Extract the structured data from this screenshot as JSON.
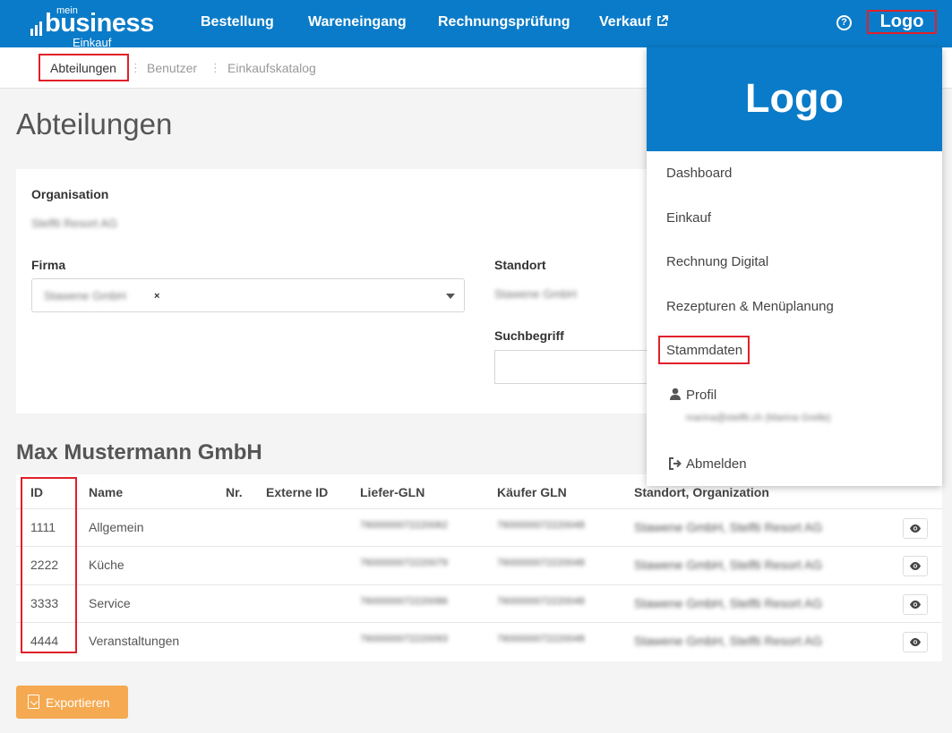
{
  "brand": {
    "mein": "mein",
    "business": "business",
    "badge": "Einkauf"
  },
  "nav": {
    "items": [
      "Bestellung",
      "Wareneingang",
      "Rechnungsprüfung",
      "Verkauf"
    ],
    "help": "?",
    "logo": "Logo"
  },
  "subnav": {
    "items": [
      "Abteilungen",
      "Benutzer",
      "Einkaufskatalog"
    ]
  },
  "page": {
    "title": "Abteilungen"
  },
  "filters": {
    "organisation_label": "Organisation",
    "organisation_value": "Stelfti Resort AG",
    "firma_label": "Firma",
    "firma_value": "Stawene GmbH",
    "clear": "×",
    "standort_label": "Standort",
    "standort_value": "Stawene GmbH",
    "suchbegriff_label": "Suchbegriff",
    "suchbegriff_value": ""
  },
  "company": "Max Mustermann GmbH",
  "table": {
    "headers": [
      "ID",
      "Name",
      "Nr.",
      "Externe ID",
      "Liefer-GLN",
      "Käufer GLN",
      "Standort, Organization"
    ],
    "rows": [
      {
        "id": "1111",
        "name": "Allgemein",
        "liefer": "7600000072220062",
        "kaeufer": "7600000072220048",
        "standort": "Stawene GmbH, Stelfti Resort AG"
      },
      {
        "id": "2222",
        "name": "Küche",
        "liefer": "7600000072220079",
        "kaeufer": "7600000072220048",
        "standort": "Stawene GmbH, Stelfti Resort AG"
      },
      {
        "id": "3333",
        "name": "Service",
        "liefer": "7600000072220086",
        "kaeufer": "7600000072220048",
        "standort": "Stawene GmbH, Stelfti Resort AG"
      },
      {
        "id": "4444",
        "name": "Veranstaltungen",
        "liefer": "7600000072220093",
        "kaeufer": "7600000072220048",
        "standort": "Stawene GmbH, Stelfti Resort AG"
      }
    ]
  },
  "export_label": "Exportieren",
  "dropdown": {
    "logo": "Logo",
    "items": [
      "Dashboard",
      "Einkauf",
      "Rechnung Digital",
      "Rezepturen & Menüplanung",
      "Stammdaten"
    ],
    "profile_label": "Profil",
    "profile_email": "marina@stelfti.ch (Marina Grelle)",
    "logout_label": "Abmelden"
  },
  "colors": {
    "primary": "#0a7bc8",
    "highlight": "#e0202a",
    "export": "#f5a950"
  }
}
